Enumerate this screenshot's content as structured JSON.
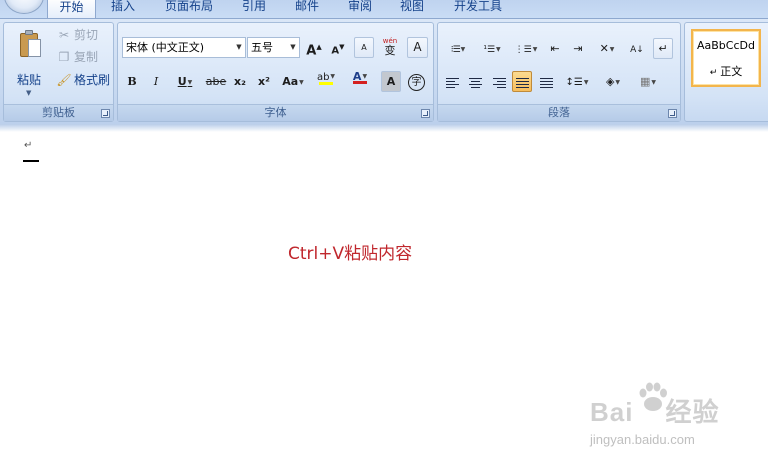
{
  "tabs": [
    {
      "label": "开始",
      "active": true
    },
    {
      "label": "插入"
    },
    {
      "label": "页面布局"
    },
    {
      "label": "引用"
    },
    {
      "label": "邮件"
    },
    {
      "label": "审阅"
    },
    {
      "label": "视图"
    },
    {
      "label": "开发工具"
    }
  ],
  "clipboard": {
    "paste_label": "粘贴",
    "cut_label": "剪切",
    "copy_label": "复制",
    "format_painter_label": "格式刷",
    "group_label": "剪贴板"
  },
  "font": {
    "font_name": "宋体 (中文正文)",
    "font_size": "五号",
    "group_label": "字体",
    "bold": "B",
    "italic": "I",
    "underline": "U",
    "strike": "abe",
    "subscript": "x₂",
    "superscript": "x²",
    "change_case": "Aa",
    "grow": "A",
    "shrink": "A",
    "clear": "A",
    "phonetic": "wén",
    "phonetic_char": "变",
    "border_char": "A",
    "highlight": "ab",
    "font_color": "A",
    "shading_char": "A",
    "enclose_char": "字"
  },
  "paragraph": {
    "group_label": "段落"
  },
  "styles": {
    "sample": "AaBbCcDd",
    "name": "正文"
  },
  "document": {
    "paragraph_mark": "↵",
    "instruction": "Ctrl+V粘贴内容"
  },
  "watermark": {
    "brand_left": "Bai",
    "brand_right": "经验",
    "url": "jingyan.baidu.com"
  },
  "colors": {
    "instruction_text": "#c0272d",
    "accent_blue": "#15428b",
    "font_color_bar": "#d42020",
    "highlight_bar": "#ffff00"
  }
}
